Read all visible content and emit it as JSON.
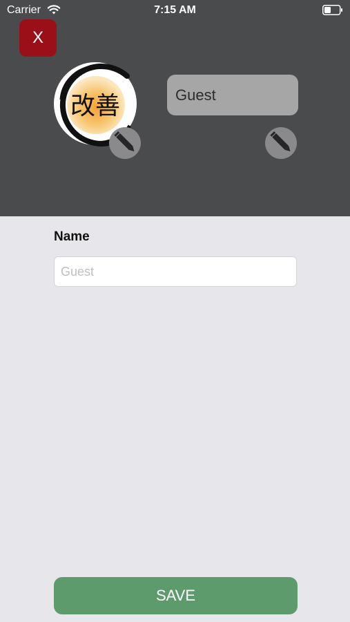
{
  "status_bar": {
    "carrier": "Carrier",
    "time": "7:15 AM"
  },
  "header": {
    "close_label": "X",
    "avatar_text": "改善",
    "name_display": "Guest",
    "background_color": "#4a4b4d",
    "close_color": "#9b0f18"
  },
  "form": {
    "name_label": "Name",
    "name_placeholder": "Guest",
    "name_value": ""
  },
  "footer": {
    "save_label": "SAVE",
    "save_color": "#5e9b6c"
  },
  "icons": {
    "wifi": "wifi-icon",
    "battery": "battery-icon",
    "avatar_edit": "pencil-icon",
    "name_edit": "pencil-icon"
  }
}
